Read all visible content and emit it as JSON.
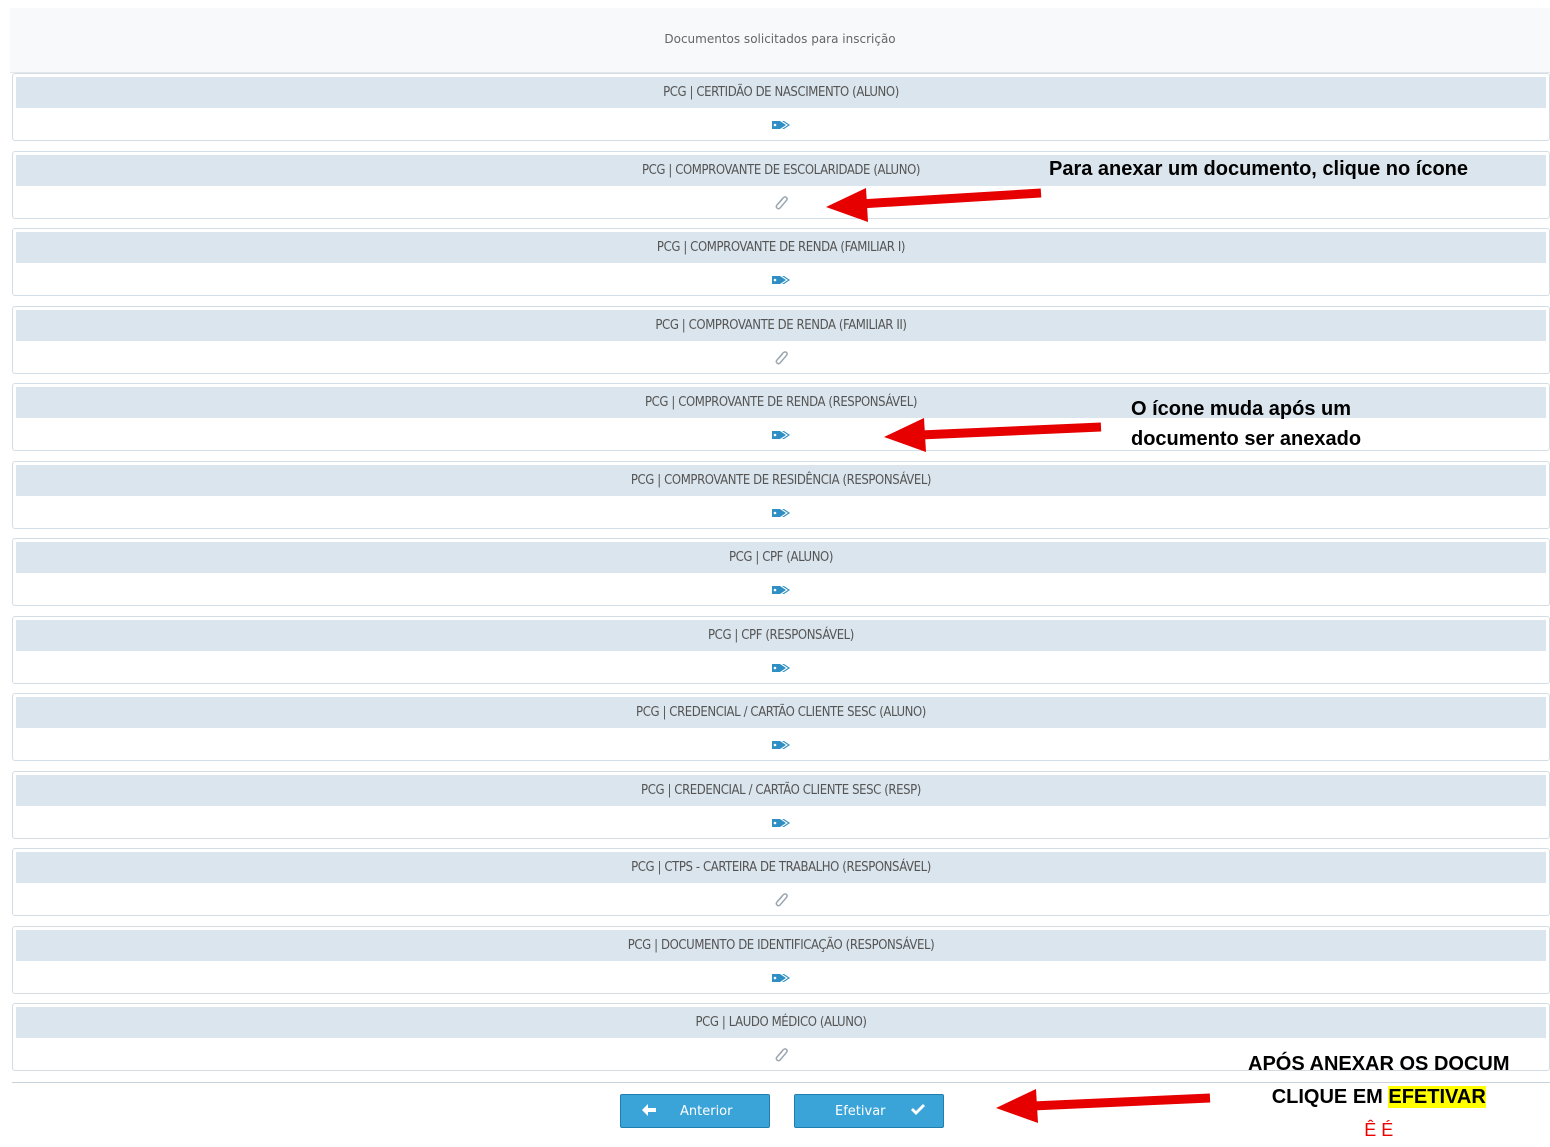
{
  "header": {
    "title": "Documentos solicitados para inscrição"
  },
  "documents": [
    {
      "label": "PCG | CERTIDÃO DE NASCIMENTO (ALUNO)",
      "icon": "tag-icon",
      "attached": true
    },
    {
      "label": "PCG | COMPROVANTE DE ESCOLARIDADE (ALUNO)",
      "icon": "paperclip-icon",
      "attached": false
    },
    {
      "label": "PCG | COMPROVANTE DE RENDA (FAMILIAR I)",
      "icon": "tag-icon",
      "attached": true
    },
    {
      "label": "PCG | COMPROVANTE DE RENDA (FAMILIAR II)",
      "icon": "paperclip-icon",
      "attached": false
    },
    {
      "label": "PCG | COMPROVANTE DE RENDA (RESPONSÁVEL)",
      "icon": "tag-icon",
      "attached": true
    },
    {
      "label": "PCG | COMPROVANTE DE RESIDÊNCIA (RESPONSÁVEL)",
      "icon": "tag-icon",
      "attached": true
    },
    {
      "label": "PCG | CPF (ALUNO)",
      "icon": "tag-icon",
      "attached": true
    },
    {
      "label": "PCG | CPF (RESPONSÁVEL)",
      "icon": "tag-icon",
      "attached": true
    },
    {
      "label": "PCG | CREDENCIAL / CARTÃO CLIENTE SESC (ALUNO)",
      "icon": "tag-icon",
      "attached": true
    },
    {
      "label": "PCG | CREDENCIAL / CARTÃO CLIENTE SESC (RESP)",
      "icon": "tag-icon",
      "attached": true
    },
    {
      "label": "PCG | CTPS - CARTEIRA DE TRABALHO (RESPONSÁVEL)",
      "icon": "paperclip-icon",
      "attached": false
    },
    {
      "label": "PCG | DOCUMENTO DE IDENTIFICAÇÃO (RESPONSÁVEL)",
      "icon": "tag-icon",
      "attached": true
    },
    {
      "label": "PCG | LAUDO MÉDICO (ALUNO)",
      "icon": "paperclip-icon",
      "attached": false
    }
  ],
  "buttons": {
    "previous_label": "Anterior",
    "submit_label": "Efetivar"
  },
  "annotations": {
    "attach_hint": "Para anexar um documento, clique no ícone",
    "icon_change_line1": "O ícone muda após um",
    "icon_change_line2": "documento ser anexado",
    "submit_line1": "APÓS ANEXAR OS DOCUM",
    "submit_line2_prefix": "CLIQUE EM ",
    "submit_line2_highlight": "EFETIVAR",
    "submit_line3_fragment": "Ê É"
  },
  "colors": {
    "accent": "#3aa4d9",
    "icon_attached": "#2f8fc4",
    "icon_empty": "#9aa6b0",
    "arrow": "#e60000",
    "highlight": "#ffff00"
  }
}
